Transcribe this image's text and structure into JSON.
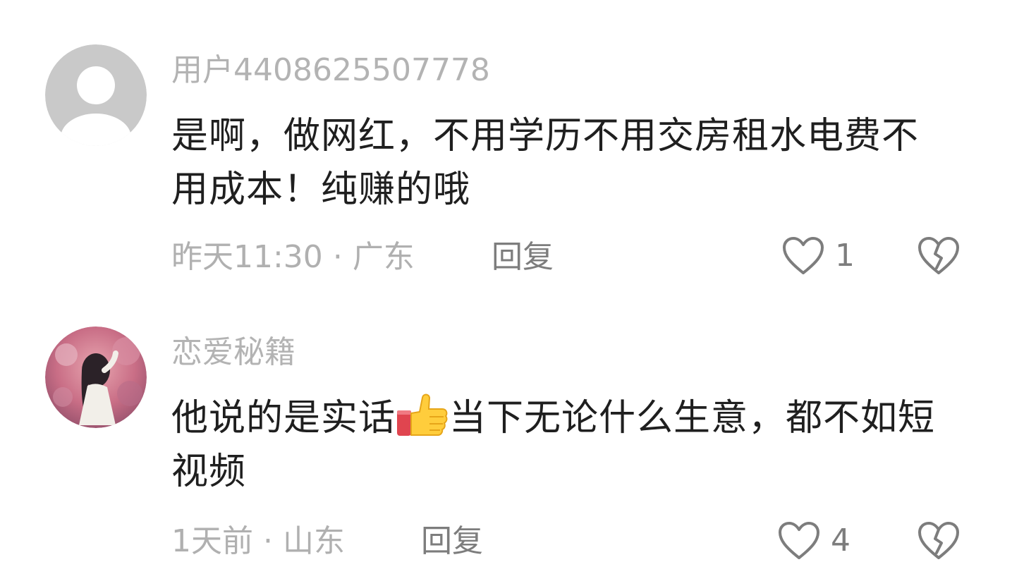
{
  "comments": [
    {
      "username": "用户4408625507778",
      "text": "是啊，做网红，不用学历不用交房租水电费不用成本！纯赚的哦",
      "time": "昨天11:30",
      "separator": "·",
      "location": "广东",
      "reply_label": "回复",
      "like_count": "1",
      "avatar": "default-user-avatar"
    },
    {
      "username": "恋爱秘籍",
      "text_before_emoji": "他说的是实话",
      "emoji": "thumbs-up",
      "text_after_emoji": "当下无论什么生意，都不如短视频",
      "time": "1天前",
      "separator": "·",
      "location": "山东",
      "reply_label": "回复",
      "like_count": "4",
      "avatar": "photo-avatar"
    }
  ],
  "colors": {
    "username": "#b3b3b3",
    "content": "#1f1f1f",
    "meta": "#b0b0b0",
    "action": "#7d7d7d"
  }
}
